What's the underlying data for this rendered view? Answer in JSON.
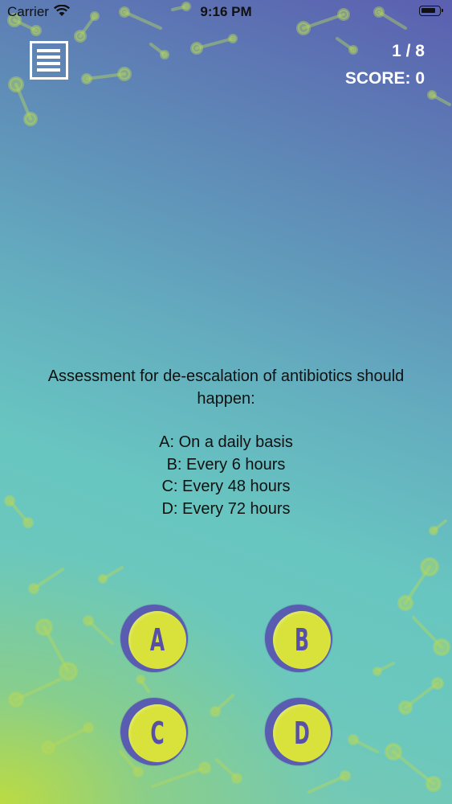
{
  "status_bar": {
    "carrier": "Carrier",
    "time": "9:16 PM"
  },
  "quiz": {
    "progress": "1 / 8",
    "score": "SCORE: 0",
    "question": "Assessment for de-escalation of antibiotics should happen:",
    "options": [
      "A: On a daily basis",
      "B: Every 6 hours",
      "C: Every 48 hours",
      "D: Every 72 hours"
    ]
  },
  "answer_buttons": [
    {
      "letter": "A"
    },
    {
      "letter": "B"
    },
    {
      "letter": "C"
    },
    {
      "letter": "D"
    }
  ],
  "icons": {
    "menu": "hamburger-menu-icon",
    "wifi": "wifi-icon",
    "battery": "battery-icon"
  },
  "colors": {
    "button_face": "#d8e23a",
    "button_ring": "#5a5cb2",
    "button_letter": "#5850a8",
    "text_light": "#ffffff",
    "text_dark": "#111111"
  }
}
